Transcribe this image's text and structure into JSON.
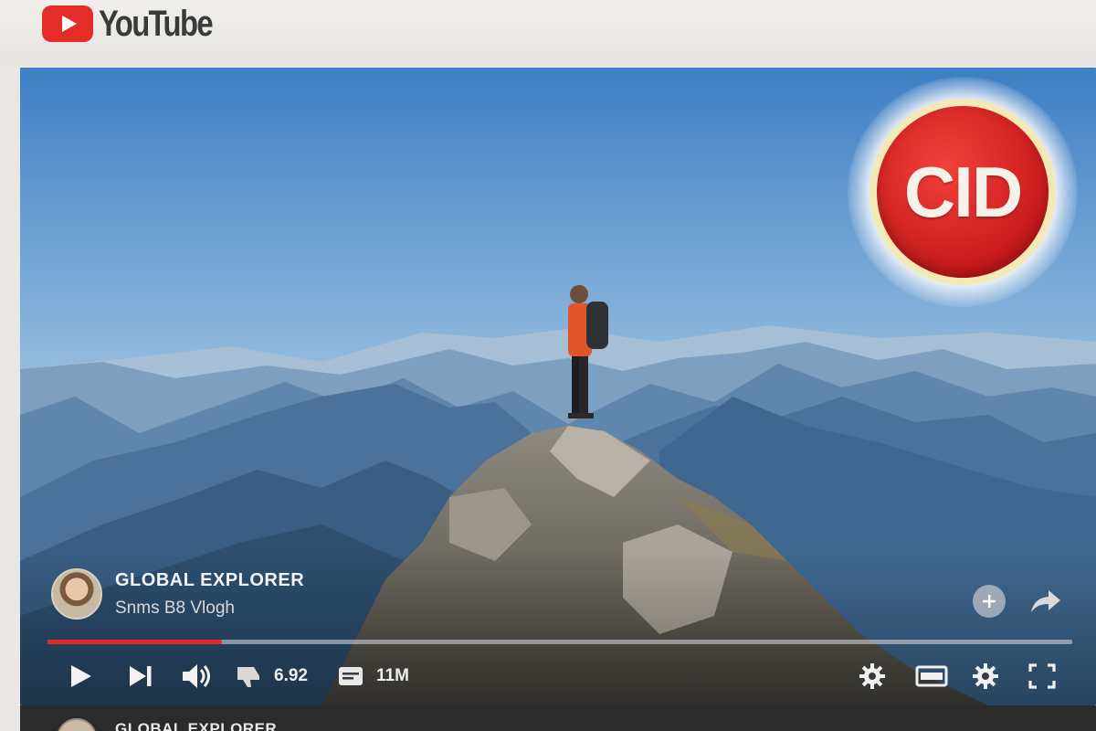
{
  "app": {
    "name": "YouTube"
  },
  "badge": {
    "text": "CID"
  },
  "channel": {
    "name": "GLOBAL EXPLORER",
    "subtitle": "Snms B8 Vlogh"
  },
  "player": {
    "progress_fraction": 0.17,
    "views_value": "6.92",
    "captions_value": "11M"
  },
  "below": {
    "channel_name": "GLOBAL EXPLORER"
  },
  "icons": {
    "play": "play-icon",
    "next": "next-icon",
    "volume": "volume-icon",
    "dislike": "thumb-icon",
    "captions": "captions-icon",
    "settings": "gear-icon",
    "theater": "theater-icon",
    "fullscreen": "fullscreen-icon",
    "add": "plus-icon",
    "share": "share-icon"
  },
  "colors": {
    "brand_red": "#e32b28",
    "badge_red": "#d21f20"
  }
}
